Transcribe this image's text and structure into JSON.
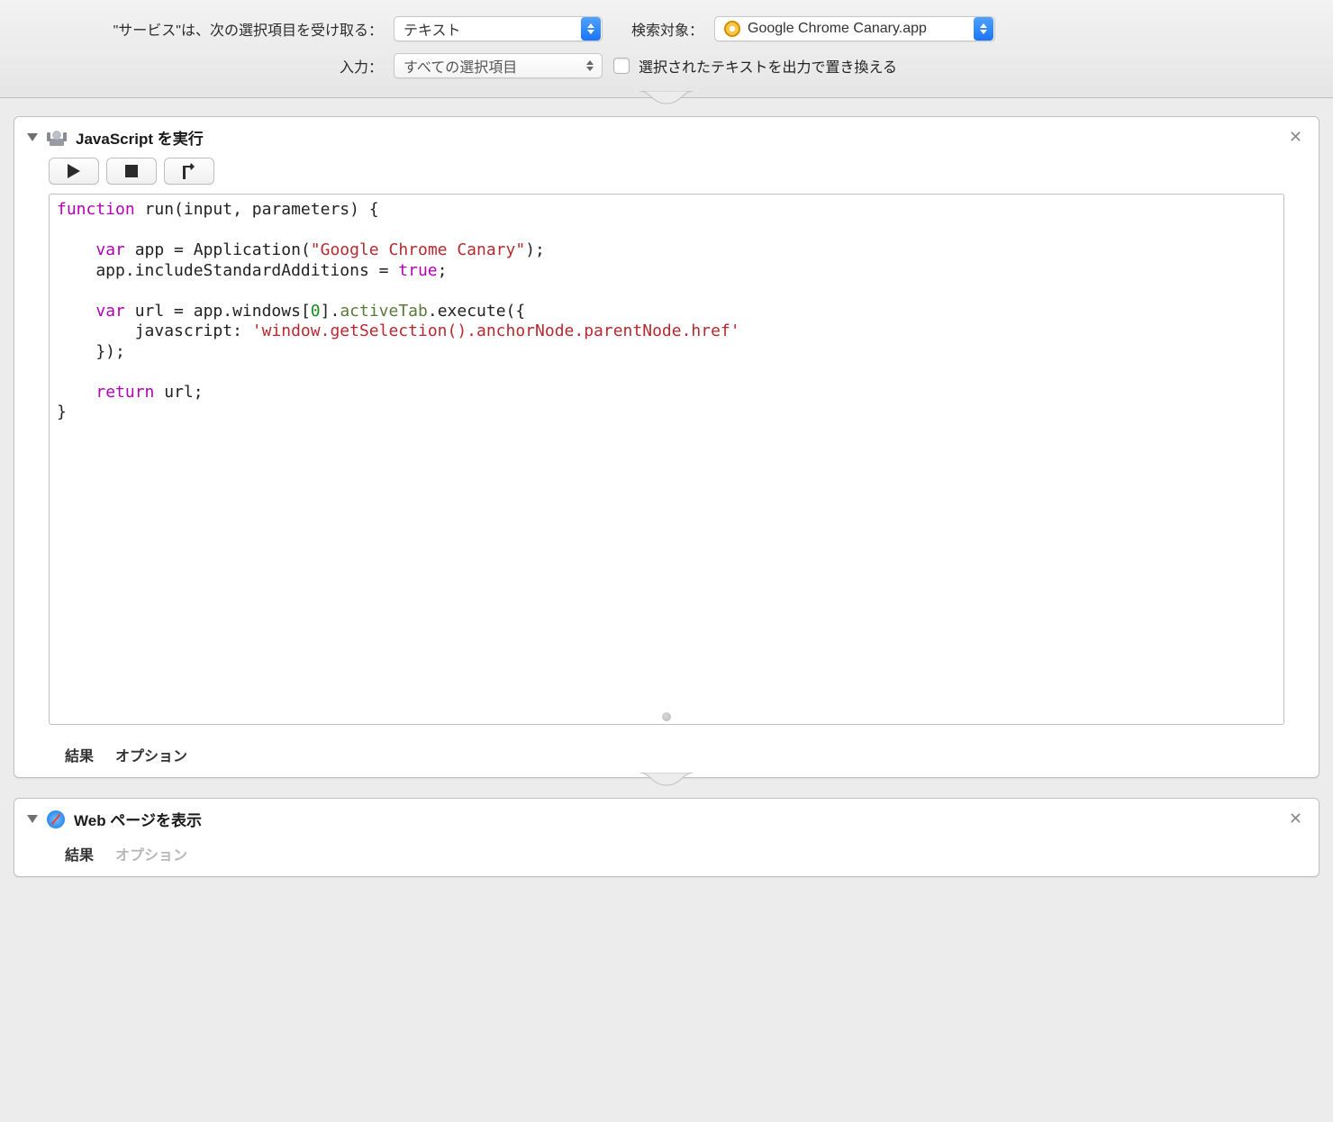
{
  "header": {
    "receives_label": "\"サービス\"は、次の選択項目を受け取る：",
    "receives_value": "テキスト",
    "search_label": "検索対象：",
    "search_value": "Google Chrome Canary.app",
    "input_label": "入力：",
    "input_value": "すべての選択項目",
    "replace_checkbox_label": "選択されたテキストを出力で置き換える"
  },
  "actions": {
    "js": {
      "title": "JavaScript を実行",
      "tabs": {
        "results": "結果",
        "options": "オプション"
      },
      "code": {
        "l1_kw": "function",
        "l1_rest": " run(input, parameters) {",
        "l3_kw": "var",
        "l3_mid": " app = Application(",
        "l3_str": "\"Google Chrome Canary\"",
        "l3_end": ");",
        "l4_a": "    app.includeStandardAdditions = ",
        "l4_kw": "true",
        "l4_end": ";",
        "l6_kw": "var",
        "l6_a": " url = app.windows[",
        "l6_num": "0",
        "l6_b": "].",
        "l6_prop": "activeTab",
        "l6_c": ".execute({",
        "l7_a": "        javascript: ",
        "l7_str": "'window.getSelection().anchorNode.parentNode.href'",
        "l8": "    });",
        "l10_kw": "return",
        "l10_rest": " url;",
        "l11": "}"
      }
    },
    "web": {
      "title": "Web ページを表示",
      "tabs": {
        "results": "結果",
        "options": "オプション"
      }
    }
  }
}
